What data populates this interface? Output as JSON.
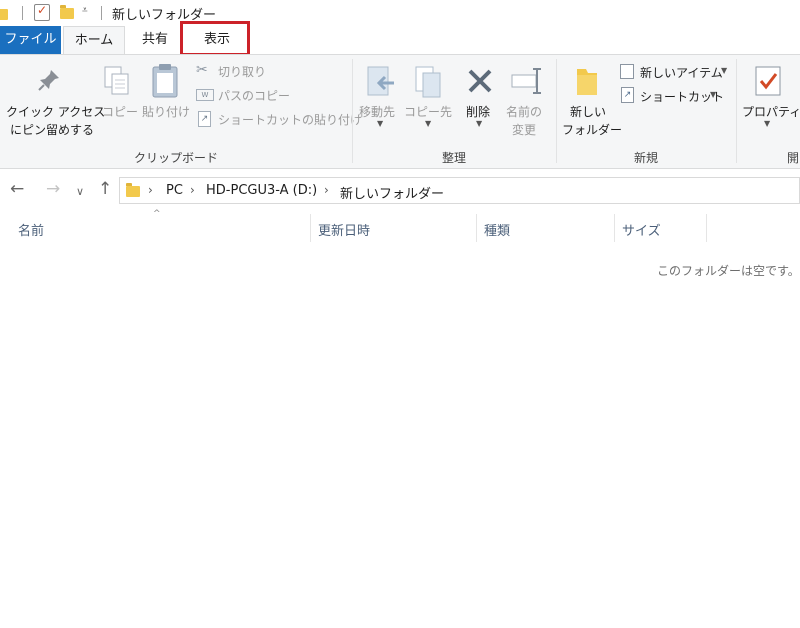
{
  "window": {
    "title": "新しいフォルダー"
  },
  "tabs": {
    "file": "ファイル",
    "home": "ホーム",
    "share": "共有",
    "view": "表示"
  },
  "ribbon": {
    "clipboard": {
      "pin_line1": "クイック アクセス",
      "pin_line2": "にピン留めする",
      "copy": "コピー",
      "paste": "貼り付け",
      "cut": "切り取り",
      "copy_path": "パスのコピー",
      "paste_shortcut": "ショートカットの貼り付け",
      "group_label": "クリップボード"
    },
    "organize": {
      "move_to": "移動先",
      "copy_to": "コピー先",
      "delete": "削除",
      "rename_line1": "名前の",
      "rename_line2": "変更",
      "group_label": "整理"
    },
    "new": {
      "new_folder_line1": "新しい",
      "new_folder_line2": "フォルダー",
      "new_item": "新しいアイテム",
      "shortcut": "ショートカット",
      "group_label": "新規"
    },
    "open": {
      "properties": "プロパティ",
      "group_label": "開"
    }
  },
  "address": {
    "crumbs": [
      "PC",
      "HD-PCGU3-A (D:)",
      "新しいフォルダー"
    ]
  },
  "columns": {
    "name": "名前",
    "modified": "更新日時",
    "type": "種類",
    "size": "サイズ"
  },
  "list": {
    "empty_message": "このフォルダーは空です。"
  },
  "colors": {
    "file_tab": "#1a6fbf",
    "highlight": "#cc2229",
    "ribbon_bg": "#f5f6f7"
  }
}
